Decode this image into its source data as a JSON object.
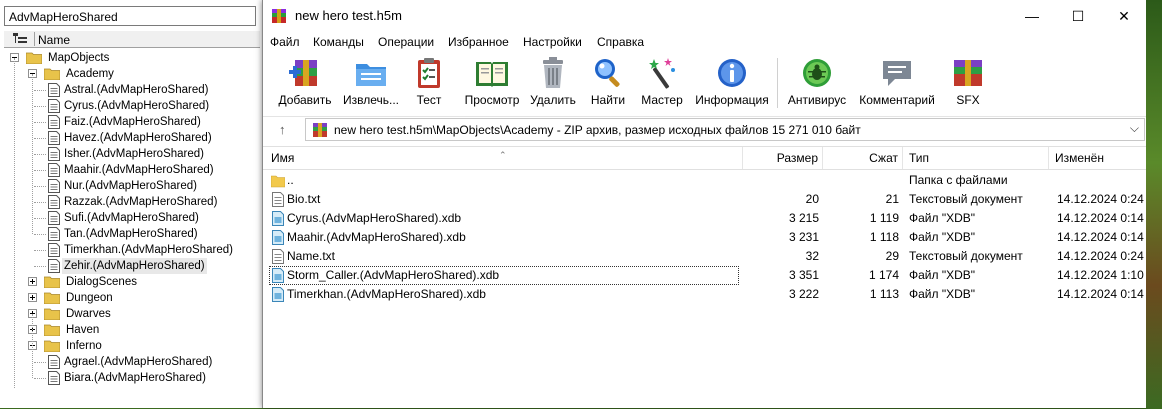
{
  "left_panel": {
    "title": "AdvMapHeroShared",
    "header": "Name",
    "tree": [
      {
        "label": "MapObjects",
        "level": 0,
        "kind": "folder",
        "expanded": true
      },
      {
        "label": "Academy",
        "level": 1,
        "kind": "folder",
        "expanded": true
      },
      {
        "label": "Astral.(AdvMapHeroShared)",
        "level": 2,
        "kind": "doc"
      },
      {
        "label": "Cyrus.(AdvMapHeroShared)",
        "level": 2,
        "kind": "doc"
      },
      {
        "label": "Faiz.(AdvMapHeroShared)",
        "level": 2,
        "kind": "doc"
      },
      {
        "label": "Havez.(AdvMapHeroShared)",
        "level": 2,
        "kind": "doc"
      },
      {
        "label": "Isher.(AdvMapHeroShared)",
        "level": 2,
        "kind": "doc"
      },
      {
        "label": "Maahir.(AdvMapHeroShared)",
        "level": 2,
        "kind": "doc"
      },
      {
        "label": "Nur.(AdvMapHeroShared)",
        "level": 2,
        "kind": "doc"
      },
      {
        "label": "Razzak.(AdvMapHeroShared)",
        "level": 2,
        "kind": "doc"
      },
      {
        "label": "Sufi.(AdvMapHeroShared)",
        "level": 2,
        "kind": "doc"
      },
      {
        "label": "Tan.(AdvMapHeroShared)",
        "level": 2,
        "kind": "doc"
      },
      {
        "label": "Timerkhan.(AdvMapHeroShared)",
        "level": 2,
        "kind": "doc"
      },
      {
        "label": "Zehir.(AdvMapHeroShared)",
        "level": 2,
        "kind": "doc",
        "selected": true
      },
      {
        "label": "DialogScenes",
        "level": 1,
        "kind": "folder",
        "expanded": false
      },
      {
        "label": "Dungeon",
        "level": 1,
        "kind": "folder",
        "expanded": false
      },
      {
        "label": "Dwarves",
        "level": 1,
        "kind": "folder",
        "expanded": false
      },
      {
        "label": "Haven",
        "level": 1,
        "kind": "folder",
        "expanded": false
      },
      {
        "label": "Inferno",
        "level": 1,
        "kind": "folder",
        "expanded": true
      },
      {
        "label": "Agrael.(AdvMapHeroShared)",
        "level": 2,
        "kind": "doc"
      },
      {
        "label": "Biara.(AdvMapHeroShared)",
        "level": 2,
        "kind": "doc"
      }
    ]
  },
  "window": {
    "title": "new hero test.h5m",
    "minimize": "—",
    "maximize": "☐",
    "close": "✕"
  },
  "menu": [
    "Файл",
    "Команды",
    "Операции",
    "Избранное",
    "Настройки",
    "Справка"
  ],
  "toolbar": [
    {
      "label": "Добавить",
      "icon": "add-archive-icon"
    },
    {
      "label": "Извлечь...",
      "icon": "extract-folder-icon"
    },
    {
      "label": "Тест",
      "icon": "test-clipboard-icon"
    },
    {
      "label": "Просмотр",
      "icon": "view-book-icon"
    },
    {
      "label": "Удалить",
      "icon": "trash-icon"
    },
    {
      "label": "Найти",
      "icon": "magnifier-icon"
    },
    {
      "label": "Мастер",
      "icon": "wizard-wand-icon"
    },
    {
      "label": "Информация",
      "icon": "info-icon"
    },
    {
      "label": "Антивирус",
      "icon": "antivirus-bug-icon"
    },
    {
      "label": "Комментарий",
      "icon": "comment-icon"
    },
    {
      "label": "SFX",
      "icon": "sfx-box-icon"
    }
  ],
  "address": {
    "up": "↑",
    "path": "new hero test.h5m\\MapObjects\\Academy - ZIP архив, размер исходных файлов 15 271 010 байт",
    "dropdown": "⌵"
  },
  "columns": {
    "name": "Имя",
    "size": "Размер",
    "packed": "Сжат",
    "type": "Тип",
    "modified": "Изменён",
    "sort_arrow": "⌃"
  },
  "files": [
    {
      "name": "..",
      "size": "",
      "packed": "",
      "type": "Папка с файлами",
      "modified": "",
      "kind": "folder"
    },
    {
      "name": "Bio.txt",
      "size": "20",
      "packed": "21",
      "type": "Текстовый документ",
      "modified": "14.12.2024 0:24",
      "kind": "txt"
    },
    {
      "name": "Cyrus.(AdvMapHeroShared).xdb",
      "size": "3 215",
      "packed": "1 119",
      "type": "Файл \"XDB\"",
      "modified": "14.12.2024 0:14",
      "kind": "xdb"
    },
    {
      "name": "Maahir.(AdvMapHeroShared).xdb",
      "size": "3 231",
      "packed": "1 118",
      "type": "Файл \"XDB\"",
      "modified": "14.12.2024 0:14",
      "kind": "xdb"
    },
    {
      "name": "Name.txt",
      "size": "32",
      "packed": "29",
      "type": "Текстовый документ",
      "modified": "14.12.2024 0:24",
      "kind": "txt"
    },
    {
      "name": "Storm_Caller.(AdvMapHeroShared).xdb",
      "size": "3 351",
      "packed": "1 174",
      "type": "Файл \"XDB\"",
      "modified": "14.12.2024 1:10",
      "kind": "xdb",
      "focused": true
    },
    {
      "name": "Timerkhan.(AdvMapHeroShared).xdb",
      "size": "3 222",
      "packed": "1 113",
      "type": "Файл \"XDB\"",
      "modified": "14.12.2024 0:14",
      "kind": "xdb"
    }
  ]
}
